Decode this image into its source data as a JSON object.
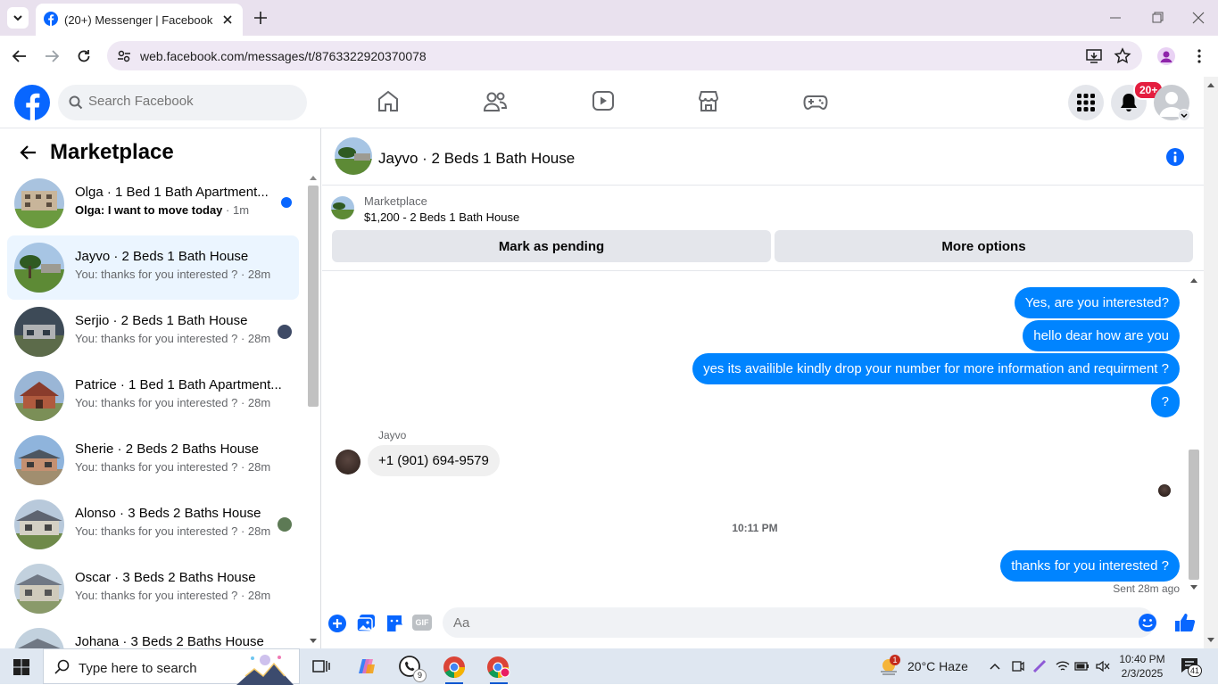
{
  "browser": {
    "tab_title": "(20+) Messenger | Facebook",
    "url": "web.facebook.com/messages/t/8763322920370078"
  },
  "header": {
    "search_placeholder": "Search Facebook",
    "notification_badge": "20+"
  },
  "sidebar": {
    "title": "Marketplace",
    "conversations": [
      {
        "name": "Olga · 1 Bed 1 Bath Apartment...",
        "preview": "Olga: I want to move today",
        "time": " · 1m",
        "unread": true
      },
      {
        "name": "Jayvo · 2 Beds 1 Bath House",
        "preview": "You: thanks for you interested ?",
        "time": " · 28m",
        "selected": true
      },
      {
        "name": "Serjio · 2 Beds 1 Bath House",
        "preview": "You: thanks for you interested ?",
        "time": " · 28m"
      },
      {
        "name": "Patrice · 1 Bed 1 Bath Apartment...",
        "preview": "You: thanks for you interested ?",
        "time": " · 28m"
      },
      {
        "name": "Sherie · 2 Beds 2 Baths House",
        "preview": "You: thanks for you interested ?",
        "time": " · 28m"
      },
      {
        "name": "Alonso · 3 Beds 2 Baths House",
        "preview": "You: thanks for you interested ?",
        "time": " · 28m"
      },
      {
        "name": "Oscar · 3 Beds 2 Baths House",
        "preview": "You: thanks for you interested ?",
        "time": " · 28m"
      },
      {
        "name": "Johana · 3 Beds 2 Baths House",
        "preview": "",
        "time": ""
      }
    ]
  },
  "chat": {
    "title": "Jayvo · 2 Beds 1 Bath House",
    "listing_label": "Marketplace",
    "listing_price": "$1,200 - 2 Beds 1 Bath House",
    "mark_pending_label": "Mark as pending",
    "more_options_label": "More options",
    "messages": {
      "m1": "Yes, are you interested?",
      "m2": "hello  dear how are you",
      "m3": "yes its availible kindly drop your number for more information and requirment ?",
      "m4": "?",
      "sender_name": "Jayvo",
      "m5": "+1 (901) 694-9579",
      "timestamp": "10:11 PM",
      "m6": "thanks for you interested ?",
      "status": "Sent 28m ago"
    },
    "composer_placeholder": "Aa"
  },
  "taskbar": {
    "search_placeholder": "Type here to search",
    "whatsapp_count": "9",
    "weather_alert": "1",
    "weather": "20°C  Haze",
    "time": "10:40 PM",
    "date": "2/3/2025",
    "notifications": "41"
  },
  "colors": {
    "facebook_blue": "#0866ff",
    "bubble_blue": "#0084ff",
    "badge_red": "#e41e3f"
  }
}
